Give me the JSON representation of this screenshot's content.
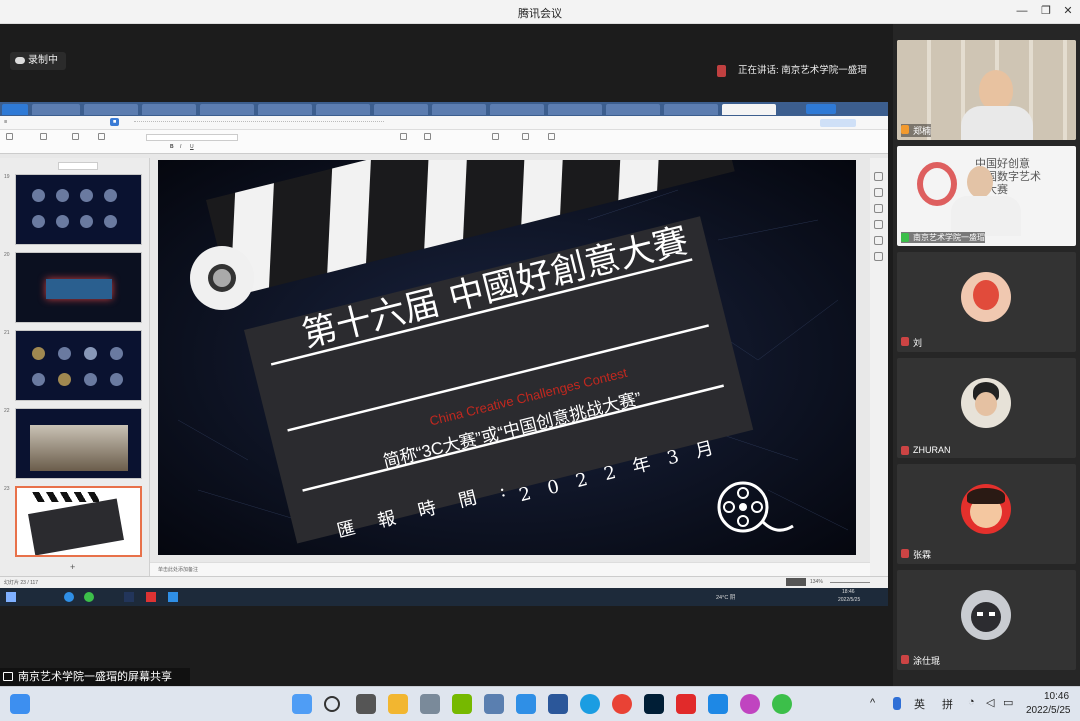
{
  "window": {
    "title": "腾讯会议"
  },
  "meeting": {
    "recording_label": "录制中",
    "speaking_label": "正在讲话: 南京艺术学院一盛瑁",
    "share_label": "南京艺术学院一盛瑁的屏幕共享"
  },
  "participants": [
    {
      "name": "郑楠"
    },
    {
      "name": "南京艺术学院一盛瑁"
    },
    {
      "name": "刘"
    },
    {
      "name": "ZHURAN"
    },
    {
      "name": "张霖"
    },
    {
      "name": "涂仕琨"
    }
  ],
  "participant2_bg_text": [
    "中国好创意",
    "全国数字艺术",
    "计大赛"
  ],
  "presentation": {
    "thumb_numbers": [
      "19",
      "20",
      "21",
      "22",
      "23"
    ],
    "slide": {
      "title": "第十六届 中國好創意大賽",
      "subtitle_en": "China Creative Challenges Contest",
      "subtitle_cn": "简称“3C大赛”或“中国创意挑战大赛”",
      "date_line": "2 0 2 2 年 3 月",
      "report_line": "匯 報 時 間 :"
    },
    "status_left": "幻灯片 23 / 117",
    "notes_placeholder": "单击此处添加备注",
    "zoom": "134%"
  },
  "colors": {
    "accent": "#3a7bd5",
    "tab_bar": "#3c5e8e",
    "slide_red": "#c2281f"
  },
  "inner_clock": {
    "time": "18:46",
    "date": "2022/5/25",
    "weather": "24°C 阴"
  },
  "taskbar": {
    "ime_1": "英",
    "ime_2": "拼",
    "time": "10:46",
    "date": "2022/5/25"
  }
}
